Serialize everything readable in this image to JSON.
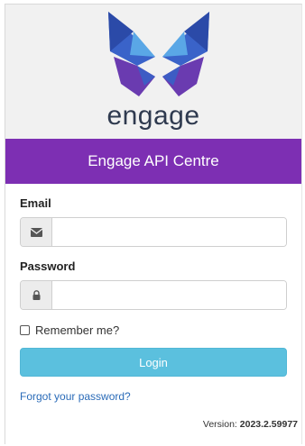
{
  "brand": {
    "wordmark": "engage",
    "colors": {
      "logo_blue": "#2f4fb8",
      "logo_light": "#5aa7e6",
      "logo_purple": "#6a3bb0",
      "wordmark": "#2f3a4f"
    }
  },
  "header": {
    "title": "Engage API Centre",
    "background": "#7d2fb3"
  },
  "form": {
    "email_label": "Email",
    "email_value": "",
    "email_icon": "envelope-icon",
    "password_label": "Password",
    "password_value": "",
    "password_icon": "lock-icon",
    "remember_label": "Remember me?",
    "remember_checked": false,
    "login_label": "Login",
    "login_color": "#5bc0de",
    "forgot_label": "Forgot your password?"
  },
  "footer": {
    "version_label": "Version:",
    "version_number": "2023.2.59977"
  }
}
